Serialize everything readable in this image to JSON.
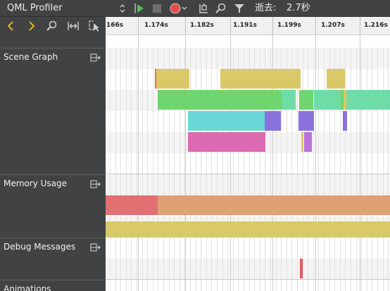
{
  "toolbar": {
    "view_selector": "QML Profiler",
    "elapsed_label": "逝去:",
    "elapsed_value": "2.7秒",
    "icons": [
      "start-profiling-icon",
      "stop-icon",
      "record-icon",
      "clear-icon",
      "search-icon",
      "filter-icon"
    ],
    "colors": {
      "record": "#e74c4c",
      "start": "#5cb85c"
    }
  },
  "nav": {
    "icons": [
      "previous-icon",
      "next-icon",
      "zoom-icon",
      "range-icon",
      "select-range-icon"
    ],
    "accent": "#f0c020"
  },
  "ruler": {
    "ticks": [
      "166s",
      "1.174s",
      "1.182s",
      "1.191s",
      "1.199s",
      "1.207s",
      "1.216s"
    ]
  },
  "categories": [
    {
      "label": "Scene Graph"
    },
    {
      "label": "Memory Usage"
    },
    {
      "label": "Debug Messages"
    },
    {
      "label": "Animations"
    }
  ],
  "event_colors": {
    "yellow": "#d9c968",
    "green": "#6fd56f",
    "teal": "#6fdca8",
    "cyan": "#6ad8d8",
    "purple": "#8a72dc",
    "pink": "#dd6bb3",
    "memory_red": "#e17072",
    "memory_orange": "#dfa074",
    "debug_red": "#e05a5a"
  }
}
